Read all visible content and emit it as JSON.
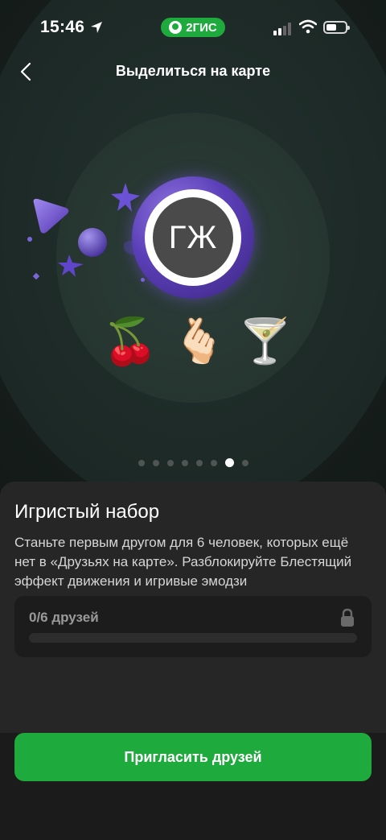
{
  "status_bar": {
    "time": "15:46",
    "app_pill": "2ГИС"
  },
  "nav": {
    "title": "Выделиться на карте"
  },
  "avatar": {
    "initials": "ГЖ"
  },
  "emojis": [
    {
      "name": "cherries",
      "glyph": "🍒"
    },
    {
      "name": "finger-heart",
      "glyph": "🫰🏻"
    },
    {
      "name": "cocktail",
      "glyph": "🍸"
    }
  ],
  "pager": {
    "total": 8,
    "active_index": 6
  },
  "sheet": {
    "title": "Игристый набор",
    "description": "Станьте первым другом для 6 человек, которых ещё нет в «Друзьях на карте». Разблокируйте Блестящий эффект движения и игривые эмодзи",
    "progress_label": "0/6 друзей",
    "progress_fraction": 0
  },
  "cta": {
    "label": "Пригласить друзей"
  },
  "colors": {
    "accent_green": "#1faa3d",
    "sheet_bg": "#262626",
    "avatar_ring": "#5b3fb8"
  }
}
